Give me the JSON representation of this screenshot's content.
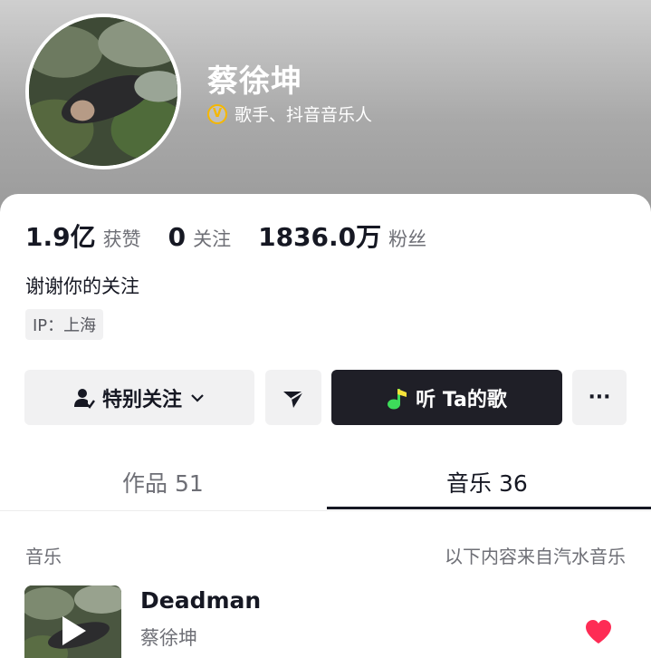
{
  "profile": {
    "name": "蔡徐坤",
    "verified_text": "歌手、抖音音乐人",
    "badge": "V"
  },
  "stats": [
    {
      "value": "1.9亿",
      "label": "获赞"
    },
    {
      "value": "0",
      "label": "关注"
    },
    {
      "value": "1836.0万",
      "label": "粉丝"
    }
  ],
  "bio": "谢谢你的关注",
  "ip": "IP：上海",
  "actions": {
    "follow_label": "特别关注",
    "listen_label": "听 Ta的歌",
    "more": "···"
  },
  "tabs": [
    {
      "label": "作品 51",
      "active": false
    },
    {
      "label": "音乐 36",
      "active": true
    }
  ],
  "music_section": {
    "title": "音乐",
    "source": "以下内容来自汽水音乐"
  },
  "songs": [
    {
      "title": "Deadman",
      "artist": "蔡徐坤",
      "liked": true
    }
  ],
  "colors": {
    "heart": "#fe2c55",
    "listen_button": "#1f1f27",
    "verify_badge": "#f5b700",
    "note_icon_green": "#3ddc5a"
  }
}
